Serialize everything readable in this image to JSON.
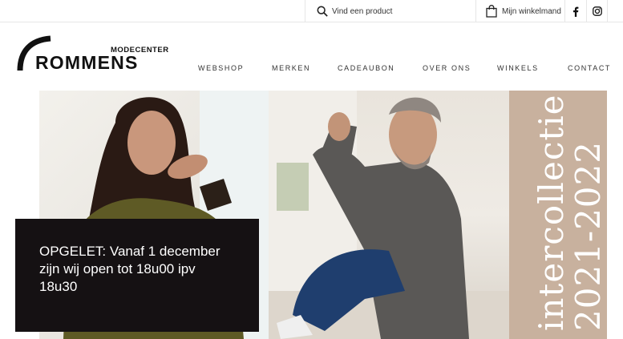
{
  "topbar": {
    "search_placeholder": "Vind een product",
    "cart_label": "Mijn winkelmand"
  },
  "logo": {
    "subtitle": "MODECENTER",
    "name": "ROMMENS"
  },
  "nav": {
    "items": [
      {
        "label": "WEBSHOP"
      },
      {
        "label": "MERKEN"
      },
      {
        "label": "CADEAUBON"
      },
      {
        "label": "OVER ONS"
      },
      {
        "label": "WINKELS"
      },
      {
        "label": "CONTACT"
      }
    ]
  },
  "hero": {
    "vertical_text_line1": "intercollectie",
    "vertical_text_line2": "2021-2022",
    "notice": "OPGELET: Vanaf 1 december zijn wij open tot 18u00 ipv 18u30"
  },
  "icons": {
    "search": "search-icon",
    "cart": "shopping-bag-icon",
    "facebook": "facebook-icon",
    "instagram": "instagram-icon"
  },
  "colors": {
    "accent_panel": "#c8b19e",
    "notice_bg": "#151113"
  }
}
